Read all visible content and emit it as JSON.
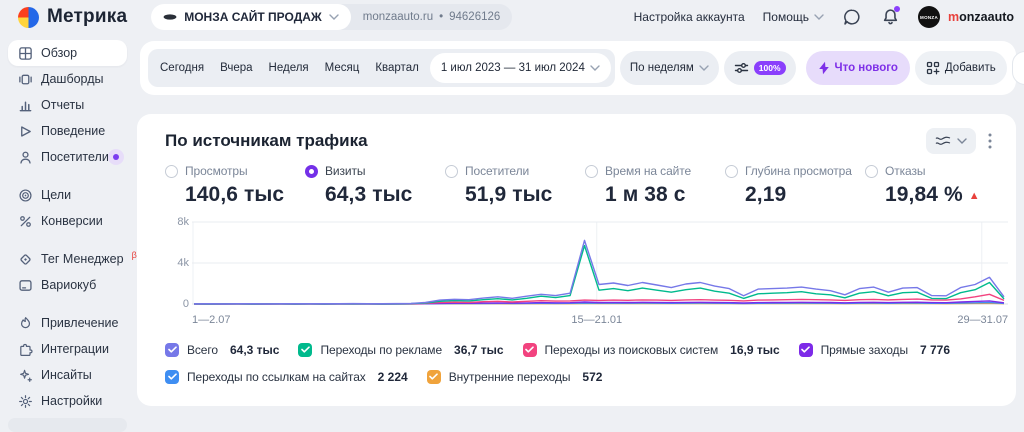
{
  "header": {
    "app_name": "Метрика",
    "site_selector": {
      "site_name": "МОНЗА САЙТ ПРОДАЖ",
      "domain": "monzaauto.ru",
      "counter_id": "94626126"
    },
    "nav": {
      "account_settings": "Настройка аккаунта",
      "help": "Помощь"
    },
    "user": {
      "name_first_letter": "m",
      "name_rest": "onzaauto",
      "avatar_text": "MONZA"
    }
  },
  "sidebar": {
    "items": [
      {
        "label": "Обзор",
        "icon": "overview-grid",
        "selected": true
      },
      {
        "label": "Дашборды",
        "icon": "dashboards"
      },
      {
        "label": "Отчеты",
        "icon": "reports-chart"
      },
      {
        "label": "Поведение",
        "icon": "behavior-play"
      },
      {
        "label": "Посетители",
        "icon": "visitors-person",
        "badge": "dot"
      },
      {
        "label": "Цели",
        "icon": "goals-target"
      },
      {
        "label": "Конверсии",
        "icon": "conversions-percent"
      },
      {
        "label": "Тег Менеджер",
        "icon": "tag-manager",
        "beta": "β"
      },
      {
        "label": "Вариокуб",
        "icon": "variocube"
      },
      {
        "label": "Привлечение",
        "icon": "acquisition-flame"
      },
      {
        "label": "Интеграции",
        "icon": "integrations-puzzle"
      },
      {
        "label": "Инсайты",
        "icon": "insights-sparkle"
      },
      {
        "label": "Настройки",
        "icon": "settings-gear"
      }
    ]
  },
  "toolbar": {
    "quick_ranges": [
      "Сегодня",
      "Вчера",
      "Неделя",
      "Месяц",
      "Квартал"
    ],
    "date_range": "1 июл 2023 — 31 июл 2024",
    "grouping": "По неделям",
    "sampling": "100%",
    "whats_new_label": "Что нового",
    "add_label": "Добавить"
  },
  "card": {
    "title": "По источникам трафика",
    "metrics": [
      {
        "label": "Просмотры",
        "value": "140,6 тыс",
        "selected": false
      },
      {
        "label": "Визиты",
        "value": "64,3 тыс",
        "selected": true
      },
      {
        "label": "Посетители",
        "value": "51,9 тыс",
        "selected": false
      },
      {
        "label": "Время на сайте",
        "value": "1 м 38 с",
        "selected": false
      },
      {
        "label": "Глубина просмотра",
        "value": "2,19",
        "selected": false
      },
      {
        "label": "Отказы",
        "value": "19,84 %",
        "selected": false,
        "trend": "up",
        "trend_color": "#e8413c"
      }
    ]
  },
  "chart_data": {
    "type": "line",
    "title": "По источникам трафика",
    "metric": "Визиты",
    "ylim": [
      0,
      8000
    ],
    "y_tick_labels": [
      "8k",
      "4k",
      "0"
    ],
    "x_tick_labels": [
      "1—2.07",
      "15—21.01",
      "29—31.07"
    ],
    "x_tick_fractions": [
      0,
      0.496,
      0.969
    ],
    "grid": true,
    "legend_position": "bottom",
    "series": [
      {
        "name": "Всего",
        "total": "64,3 тыс",
        "color": "#7678e8",
        "values": [
          20,
          25,
          20,
          30,
          25,
          20,
          30,
          25,
          30,
          25,
          30,
          35,
          30,
          25,
          35,
          60,
          150,
          380,
          460,
          420,
          580,
          700,
          560,
          760,
          950,
          820,
          1050,
          6200,
          1900,
          2050,
          1800,
          2100,
          1850,
          1600,
          1950,
          2100,
          1750,
          1500,
          800,
          1450,
          1500,
          1550,
          1650,
          1450,
          1300,
          900,
          1500,
          1650,
          1150,
          1550,
          1600,
          820,
          800,
          1600,
          1900,
          2600,
          700
        ]
      },
      {
        "name": "Переходы по рекламе",
        "total": "36,7 тыс",
        "color": "#00ba8d",
        "values": [
          10,
          12,
          10,
          15,
          12,
          10,
          15,
          12,
          15,
          12,
          15,
          18,
          15,
          12,
          18,
          40,
          100,
          260,
          340,
          300,
          420,
          520,
          400,
          560,
          760,
          620,
          820,
          5700,
          1350,
          1500,
          1300,
          1550,
          1350,
          1150,
          1400,
          1550,
          1250,
          1050,
          550,
          1000,
          1050,
          1100,
          1200,
          1000,
          900,
          600,
          1050,
          1200,
          800,
          1100,
          1150,
          550,
          530,
          1100,
          1400,
          2100,
          500
        ]
      },
      {
        "name": "Переходы из поисковых систем",
        "total": "16,9 тыс",
        "color": "#f2437f",
        "values": [
          5,
          6,
          5,
          8,
          6,
          5,
          8,
          6,
          8,
          6,
          8,
          10,
          8,
          6,
          10,
          20,
          60,
          140,
          180,
          160,
          220,
          260,
          200,
          260,
          320,
          280,
          300,
          380,
          350,
          380,
          360,
          400,
          380,
          350,
          400,
          420,
          380,
          360,
          300,
          380,
          400,
          420,
          450,
          420,
          400,
          350,
          420,
          450,
          400,
          450,
          480,
          400,
          380,
          500,
          700,
          950,
          350
        ]
      },
      {
        "name": "Прямые заходы",
        "total": "7 776",
        "color": "#7d2ae8",
        "values": [
          3,
          4,
          3,
          5,
          4,
          3,
          5,
          4,
          5,
          4,
          5,
          6,
          5,
          4,
          6,
          10,
          30,
          60,
          80,
          70,
          90,
          110,
          90,
          110,
          140,
          120,
          130,
          200,
          150,
          160,
          150,
          170,
          160,
          140,
          160,
          170,
          150,
          140,
          100,
          140,
          150,
          160,
          170,
          160,
          150,
          120,
          160,
          170,
          140,
          170,
          180,
          140,
          130,
          200,
          250,
          300,
          120
        ]
      },
      {
        "name": "Переходы по ссылкам на сайтах",
        "total": "2 224",
        "color": "#3f8ef2",
        "values": [
          2,
          3,
          2,
          3,
          3,
          2,
          3,
          3,
          3,
          3,
          3,
          4,
          3,
          3,
          4,
          6,
          15,
          30,
          40,
          35,
          45,
          55,
          45,
          55,
          70,
          60,
          65,
          100,
          75,
          80,
          75,
          85,
          80,
          70,
          80,
          85,
          75,
          70,
          50,
          70,
          75,
          80,
          85,
          80,
          75,
          60,
          80,
          85,
          70,
          85,
          90,
          70,
          65,
          100,
          120,
          150,
          60
        ]
      },
      {
        "name": "Внутренние переходы",
        "total": "572",
        "color": "#f0a33c",
        "values": [
          8,
          10,
          8,
          10,
          9,
          8,
          10,
          9,
          10,
          9,
          10,
          11,
          10,
          9,
          11,
          12,
          15,
          18,
          22,
          20,
          25,
          28,
          24,
          28,
          34,
          30,
          32,
          45,
          38,
          40,
          38,
          42,
          40,
          36,
          40,
          42,
          38,
          36,
          28,
          36,
          38,
          40,
          42,
          40,
          38,
          30,
          40,
          42,
          36,
          42,
          45,
          36,
          34,
          50,
          60,
          70,
          30
        ]
      }
    ]
  }
}
